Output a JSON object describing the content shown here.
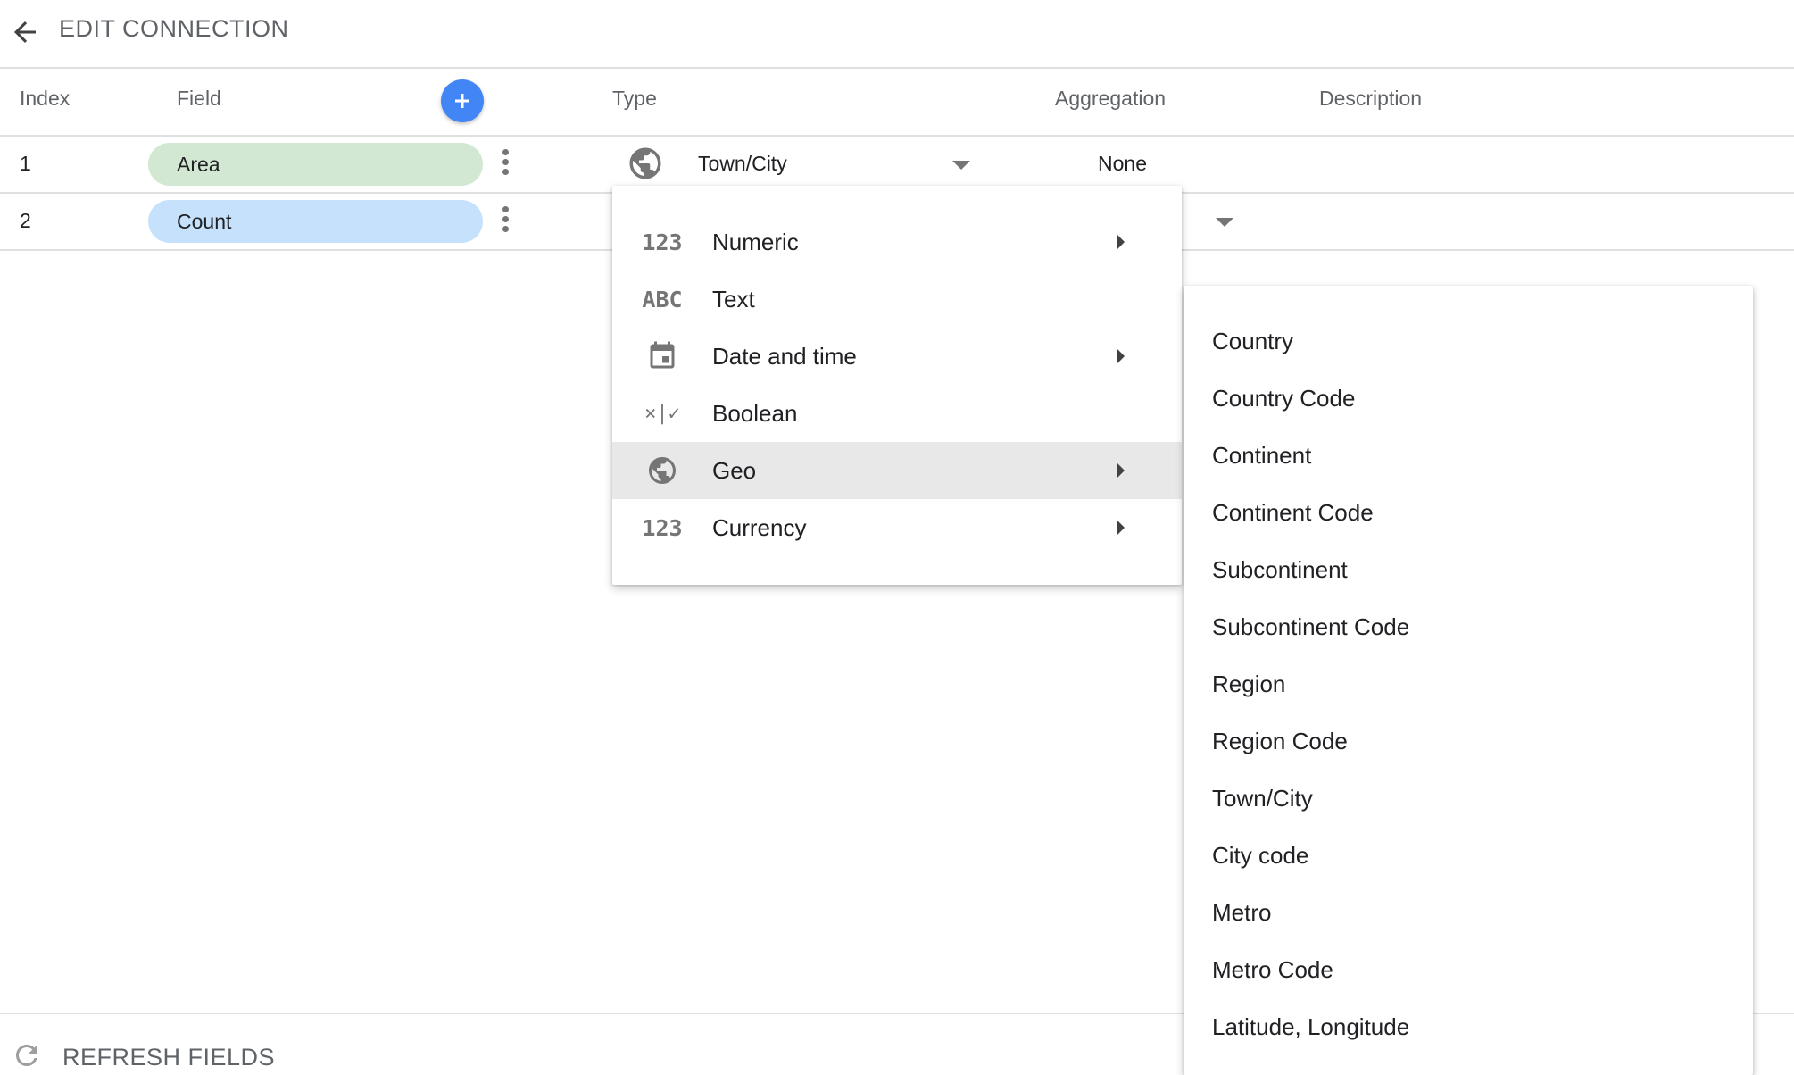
{
  "header": {
    "title": "EDIT CONNECTION"
  },
  "columns": {
    "index": "Index",
    "field": "Field",
    "add_button_icon": "plus-icon",
    "type": "Type",
    "aggregation": "Aggregation",
    "description": "Description"
  },
  "rows": [
    {
      "index": "1",
      "field": "Area",
      "field_color": "#d2e8d3",
      "type": "Town/City",
      "aggregation": "None"
    },
    {
      "index": "2",
      "field": "Count",
      "field_color": "#c6e1fb"
    }
  ],
  "type_menu": {
    "items": [
      {
        "label": "Numeric",
        "icon": "123",
        "has_submenu": true
      },
      {
        "label": "Text",
        "icon": "ABC",
        "has_submenu": false
      },
      {
        "label": "Date and time",
        "icon": "calendar-icon",
        "has_submenu": true
      },
      {
        "label": "Boolean",
        "icon": "×|✓",
        "has_submenu": false
      },
      {
        "label": "Geo",
        "icon": "globe-icon",
        "has_submenu": true,
        "selected": true
      },
      {
        "label": "Currency",
        "icon": "123",
        "has_submenu": true
      }
    ]
  },
  "geo_menu": {
    "items": [
      "Country",
      "Country Code",
      "Continent",
      "Continent Code",
      "Subcontinent",
      "Subcontinent Code",
      "Region",
      "Region Code",
      "Town/City",
      "City code",
      "Metro",
      "Metro Code",
      "Latitude, Longitude"
    ]
  },
  "footer": {
    "refresh_label": "REFRESH FIELDS"
  },
  "colors": {
    "accent": "#4285f4",
    "pill_green": "#d2e8d3",
    "pill_blue": "#c6e1fb",
    "selected_bg": "#e8e8e8"
  }
}
